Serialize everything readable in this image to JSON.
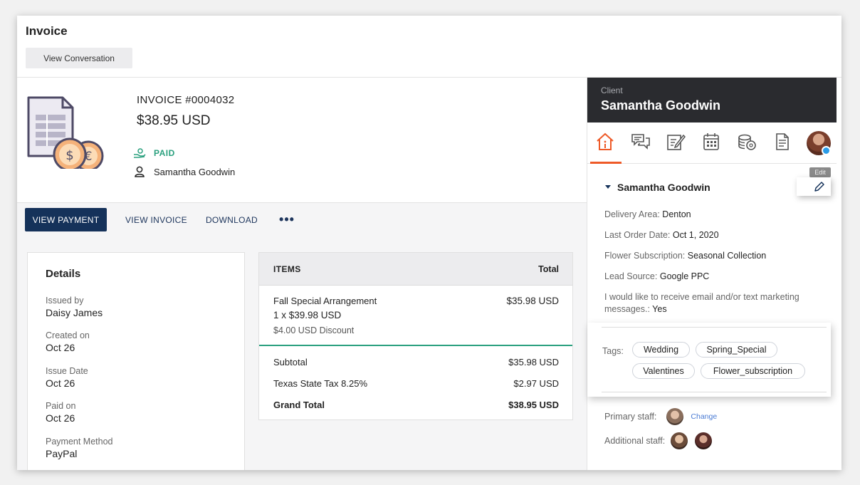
{
  "header": {
    "title": "Invoice",
    "view_conversation_label": "View Conversation"
  },
  "invoice": {
    "number": "INVOICE #0004032",
    "amount": "$38.95 USD",
    "status": "PAID",
    "client": "Samantha Goodwin"
  },
  "actions": {
    "view_payment": "VIEW PAYMENT",
    "view_invoice": "VIEW INVOICE",
    "download": "DOWNLOAD",
    "more": "•••"
  },
  "details": {
    "title": "Details",
    "issued_by_label": "Issued by",
    "issued_by": "Daisy James",
    "created_on_label": "Created on",
    "created_on": "Oct 26",
    "issue_date_label": "Issue Date",
    "issue_date": "Oct 26",
    "paid_on_label": "Paid on",
    "paid_on": "Oct 26",
    "payment_method_label": "Payment Method",
    "payment_method": "PayPal"
  },
  "items": {
    "header_items": "ITEMS",
    "header_total": "Total",
    "line": {
      "name": "Fall Special Arrangement",
      "qty": "1 x $39.98 USD",
      "discount": "$4.00 USD Discount",
      "total": "$35.98 USD"
    },
    "subtotal_label": "Subtotal",
    "subtotal": "$35.98 USD",
    "tax_label": "Texas State Tax 8.25%",
    "tax": "$2.97 USD",
    "grand_total_label": "Grand Total",
    "grand_total": "$38.95 USD"
  },
  "client_panel": {
    "label": "Client",
    "name": "Samantha Goodwin",
    "section_name": "Samantha Goodwin",
    "edit_tooltip": "Edit",
    "delivery_area_label": "Delivery Area:",
    "delivery_area": "Denton",
    "last_order_label": "Last Order Date:",
    "last_order": "Oct 1, 2020",
    "subscription_label": "Flower Subscription:",
    "subscription": "Seasonal Collection",
    "lead_source_label": "Lead Source:",
    "lead_source": "Google PPC",
    "marketing_label": "I would like to receive email and/or text marketing messages.:",
    "marketing": "Yes",
    "tags_label": "Tags:",
    "tags": [
      "Wedding",
      "Spring_Special",
      "Valentines",
      "Flower_subscription"
    ],
    "primary_staff_label": "Primary staff:",
    "change_label": "Change",
    "additional_staff_label": "Additional staff:"
  },
  "colors": {
    "primary_button": "#15325a",
    "paid_green": "#2aa07e",
    "active_tab": "#ee5a28",
    "panel_header": "#2a2b2f"
  }
}
